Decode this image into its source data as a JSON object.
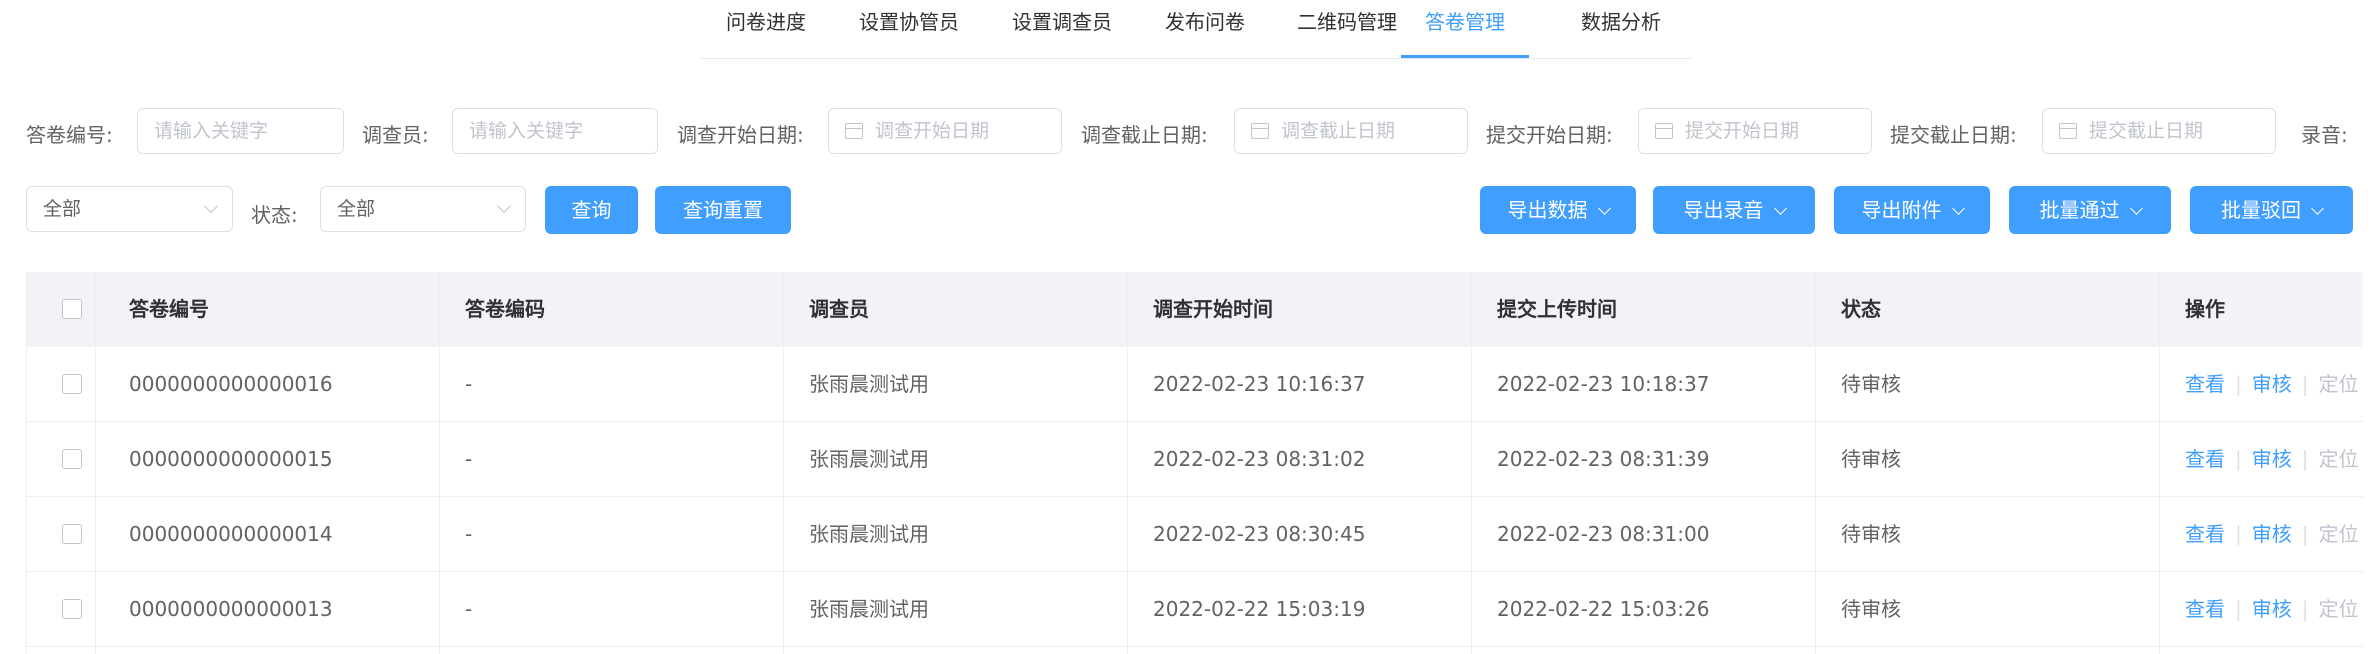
{
  "tabs": [
    "问卷进度",
    "设置协管员",
    "设置调查员",
    "发布问卷",
    "二维码管理",
    "答卷管理",
    "数据分析"
  ],
  "active_tab": "答卷管理",
  "filters": {
    "answer_no_label": "答卷编号:",
    "answer_no_placeholder": "请输入关键字",
    "surveyor_label": "调查员:",
    "surveyor_placeholder": "请输入关键字",
    "survey_start_label": "调查开始日期:",
    "survey_start_placeholder": "调查开始日期",
    "survey_end_label": "调查截止日期:",
    "survey_end_placeholder": "调查截止日期",
    "submit_start_label": "提交开始日期:",
    "submit_start_placeholder": "提交开始日期",
    "submit_end_label": "提交截止日期:",
    "submit_end_placeholder": "提交截止日期",
    "recording_label": "录音:",
    "recording_value": "全部",
    "status_label": "状态:",
    "status_value": "全部"
  },
  "buttons": {
    "query": "查询",
    "reset": "查询重置",
    "export_data": "导出数据",
    "export_recording": "导出录音",
    "export_attachment": "导出附件",
    "batch_approve": "批量通过",
    "batch_reject": "批量驳回"
  },
  "table": {
    "headers": [
      "答卷编号",
      "答卷编码",
      "调查员",
      "调查开始时间",
      "提交上传时间",
      "状态",
      "操作"
    ],
    "rows": [
      {
        "no": "0000000000000016",
        "code": "-",
        "surveyor": "张雨晨测试用",
        "start": "2022-02-23 10:16:37",
        "submit": "2022-02-23 10:18:37",
        "status": "待审核"
      },
      {
        "no": "0000000000000015",
        "code": "-",
        "surveyor": "张雨晨测试用",
        "start": "2022-02-23 08:31:02",
        "submit": "2022-02-23 08:31:39",
        "status": "待审核"
      },
      {
        "no": "0000000000000014",
        "code": "-",
        "surveyor": "张雨晨测试用",
        "start": "2022-02-23 08:30:45",
        "submit": "2022-02-23 08:31:00",
        "status": "待审核"
      },
      {
        "no": "0000000000000013",
        "code": "-",
        "surveyor": "张雨晨测试用",
        "start": "2022-02-22 15:03:19",
        "submit": "2022-02-22 15:03:26",
        "status": "待审核"
      }
    ],
    "actions": {
      "view": "查看",
      "review": "审核",
      "locate": "定位",
      "separator": "|"
    }
  },
  "colors": {
    "primary": "#409eff",
    "header_bg": "#f2f3f7",
    "disabled": "#c0c4cc"
  }
}
